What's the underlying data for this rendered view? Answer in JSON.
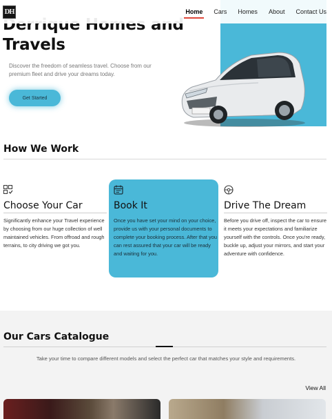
{
  "header": {
    "logo_text": "DH",
    "nav": [
      {
        "label": "Home",
        "active": true
      },
      {
        "label": "Cars",
        "active": false
      },
      {
        "label": "Homes",
        "active": false
      },
      {
        "label": "About",
        "active": false
      },
      {
        "label": "Contact Us",
        "active": false
      }
    ]
  },
  "hero": {
    "title": "Derrique Homes and Travels",
    "subtitle": "Discover the freedom of seamless travel. Choose from our premium fleet and drive your dreams today.",
    "cta_label": "Get Started",
    "accent_color": "#4ab8d8"
  },
  "how_we_work": {
    "title": "How We Work",
    "cards": [
      {
        "icon": "car-select-icon",
        "title": "Choose Your Car",
        "text": "Significantly enhance your Travel experience by choosing from our huge collection of well maintained vehicles. From offroad and rough terrains, to city driving we got you."
      },
      {
        "icon": "calendar-icon",
        "title": "Book It",
        "text": "Once you have set your mind on your choice, provide us with your personal documents to complete your booking process. After that you can rest assured that your car will be ready and waiting for you."
      },
      {
        "icon": "steering-wheel-icon",
        "title": "Drive The Dream",
        "text": "Before you drive off, inspect the car to ensure it meets your expectations and familiarize yourself with the controls. Once you're ready, buckle up, adjust your mirrors, and start your adventure with confidence."
      }
    ]
  },
  "catalogue": {
    "title": "Our Cars Catalogue",
    "subtitle": "Take your time to compare different models and select the perfect car that matches your style and requirements.",
    "view_all_label": "View All"
  }
}
